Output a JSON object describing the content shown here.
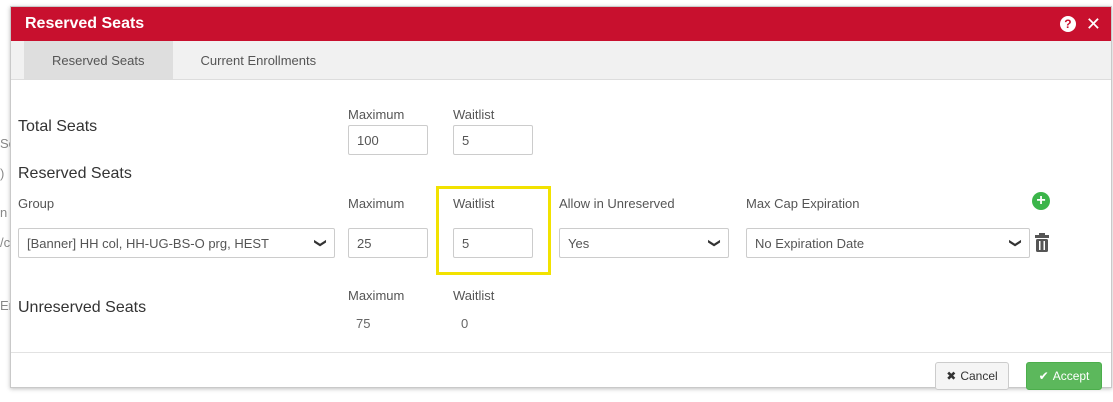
{
  "dialog": {
    "title": "Reserved Seats",
    "help_icon": "help-icon",
    "close_icon": "close-icon"
  },
  "tabs": [
    {
      "label": "Reserved Seats",
      "active": true
    },
    {
      "label": "Current Enrollments",
      "active": false
    }
  ],
  "total_seats": {
    "heading": "Total Seats",
    "maximum_label": "Maximum",
    "waitlist_label": "Waitlist",
    "maximum_value": "100",
    "waitlist_value": "5"
  },
  "reserved_seats": {
    "heading": "Reserved Seats",
    "columns": {
      "group": "Group",
      "maximum": "Maximum",
      "waitlist": "Waitlist",
      "allow_unreserved": "Allow in Unreserved",
      "max_cap_expiration": "Max Cap Expiration"
    },
    "row": {
      "group": "[Banner] HH col, HH-UG-BS-O prg, HEST",
      "maximum": "25",
      "waitlist": "5",
      "allow_unreserved": "Yes",
      "max_cap_expiration": "No Expiration Date"
    }
  },
  "unreserved_seats": {
    "heading": "Unreserved Seats",
    "maximum_label": "Maximum",
    "waitlist_label": "Waitlist",
    "maximum_value": "75",
    "waitlist_value": "0"
  },
  "footer": {
    "cancel_label": "Cancel",
    "accept_label": "Accept"
  },
  "background_fragments": [
    "Se",
    ")",
    "n",
    "/c",
    "Er"
  ],
  "colors": {
    "titlebar": "#c8102e",
    "highlight": "#f2e200",
    "accept": "#5cb85c",
    "add": "#3bb54a"
  }
}
